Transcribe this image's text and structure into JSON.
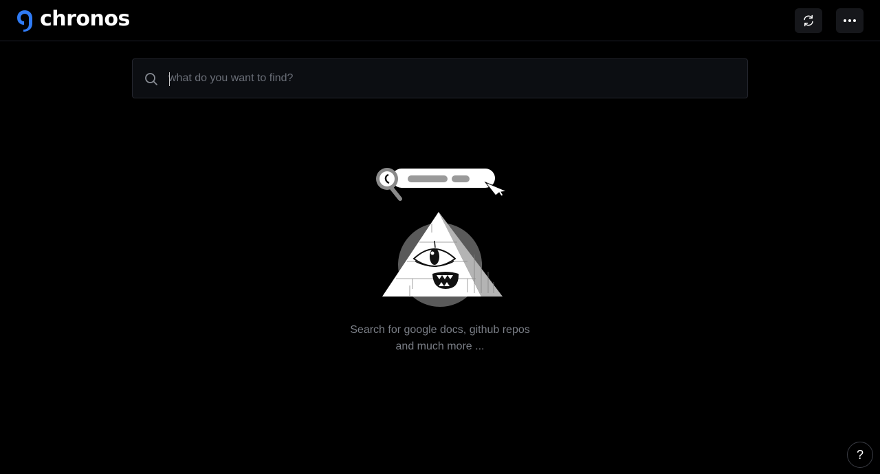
{
  "header": {
    "brand_name": "chronos",
    "logo_icon": "chronos-logo-icon",
    "refresh_icon": "refresh-icon",
    "more_icon": "more-horizontal-icon"
  },
  "search": {
    "placeholder": "what do you want to find?",
    "value": "",
    "icon": "search-icon"
  },
  "empty_state": {
    "line1": "Search for google docs, github repos",
    "line2": "and much more ..."
  },
  "help": {
    "label": "?"
  },
  "colors": {
    "background": "#000000",
    "brand_blue": "#2f7bf5",
    "muted_text": "#7a7e86",
    "input_bg": "#0c0e12"
  }
}
